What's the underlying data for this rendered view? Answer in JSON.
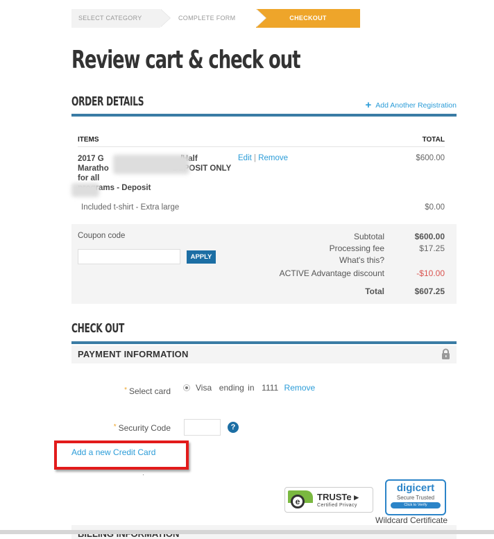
{
  "steps": [
    {
      "label": "Select Category",
      "active": false
    },
    {
      "label": "Complete Form",
      "active": false
    },
    {
      "label": "Checkout",
      "active": true
    }
  ],
  "page_title": "Review cart & check out",
  "order_details": {
    "title": "ORDER DETAILS",
    "add_registration": "Add Another Registration",
    "columns": {
      "items": "ITEMS",
      "total": "TOTAL"
    },
    "item": {
      "name_line1": "2017 G",
      "name_line1_end": "/Half",
      "name_line2": "Maratho",
      "name_line2_end": "DEPOSIT ONLY for all",
      "name_line3": "programs - Deposit",
      "edit": "Edit",
      "separator": "|",
      "remove": "Remove",
      "price": "$600.00"
    },
    "sub_item": {
      "label": "Included t-shirt - Extra large",
      "price": "$0.00"
    },
    "coupon": {
      "label": "Coupon code",
      "value": "",
      "placeholder": "",
      "apply": "APPLY"
    },
    "summary": {
      "subtotal_label": "Subtotal",
      "subtotal": "$600.00",
      "fee_label": "Processing fee",
      "fee": "$17.25",
      "whats_this": "What's this?",
      "discount_label": "ACTIVE Advantage discount",
      "discount": "-$10.00",
      "total_label": "Total",
      "total": "$607.25"
    }
  },
  "checkout": {
    "title": "CHECK OUT",
    "payment_title": "PAYMENT INFORMATION",
    "select_card_label": "Select card",
    "card_text": "Visa  ending in  1111",
    "card_remove": "Remove",
    "security_code_label": "Security Code",
    "security_code_value": "",
    "help": "?",
    "required_mark": "*",
    "add_card": "Add a new Credit Card"
  },
  "badges": {
    "truste_title": "TRUSTe",
    "truste_sub": "Certified Privacy",
    "digicert_title_a": "digi",
    "digicert_title_b": "cert",
    "digicert_sub": "Secure  Trusted",
    "digicert_verify": "Click to Verify",
    "wildcard": "Wildcard Certificate"
  },
  "billing_title": "BILLING INFORMATION",
  "colors": {
    "accent": "#eea52a",
    "link": "#2b9cd8",
    "bar": "#3a7ca5",
    "button": "#1c6ea4",
    "highlight": "#e21b1b",
    "negative": "#d9534f"
  }
}
